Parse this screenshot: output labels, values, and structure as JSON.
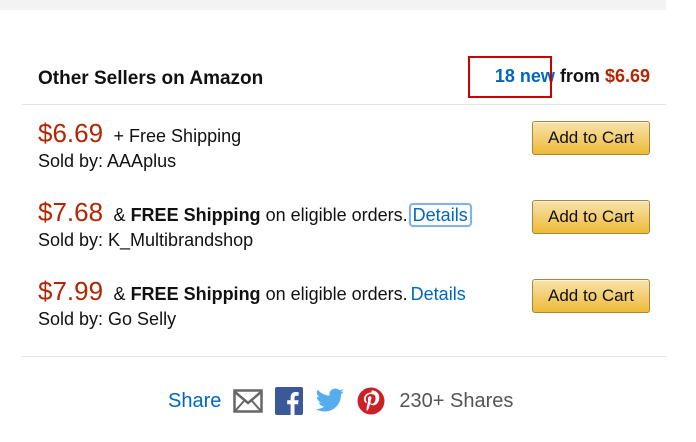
{
  "header": {
    "title": "Other Sellers on Amazon",
    "new_count_link": "18 new",
    "from_text": "from",
    "from_price": "$6.69"
  },
  "offers": [
    {
      "price": "$6.69",
      "shipping_prefix": "+ Free Shipping",
      "shipping_bold": "",
      "shipping_suffix": "",
      "details": "",
      "seller": "Sold by: AAAplus",
      "cart": "Add to Cart"
    },
    {
      "price": "$7.68",
      "shipping_prefix": "&",
      "shipping_bold": "FREE Shipping",
      "shipping_suffix": "on eligible orders.",
      "details": "Details",
      "seller": "Sold by: K_Multibrandshop",
      "cart": "Add to Cart"
    },
    {
      "price": "$7.99",
      "shipping_prefix": "&",
      "shipping_bold": "FREE Shipping",
      "shipping_suffix": "on eligible orders.",
      "details": "Details",
      "seller": "Sold by: Go Selly",
      "cart": "Add to Cart"
    }
  ],
  "share": {
    "label": "Share",
    "icons": [
      "email-icon",
      "facebook-icon",
      "twitter-icon",
      "pinterest-icon"
    ],
    "count": "230+ Shares"
  },
  "colors": {
    "link": "#0066c0",
    "price": "#b12704",
    "button": "#f0c14b",
    "highlight": "#cc0000"
  }
}
